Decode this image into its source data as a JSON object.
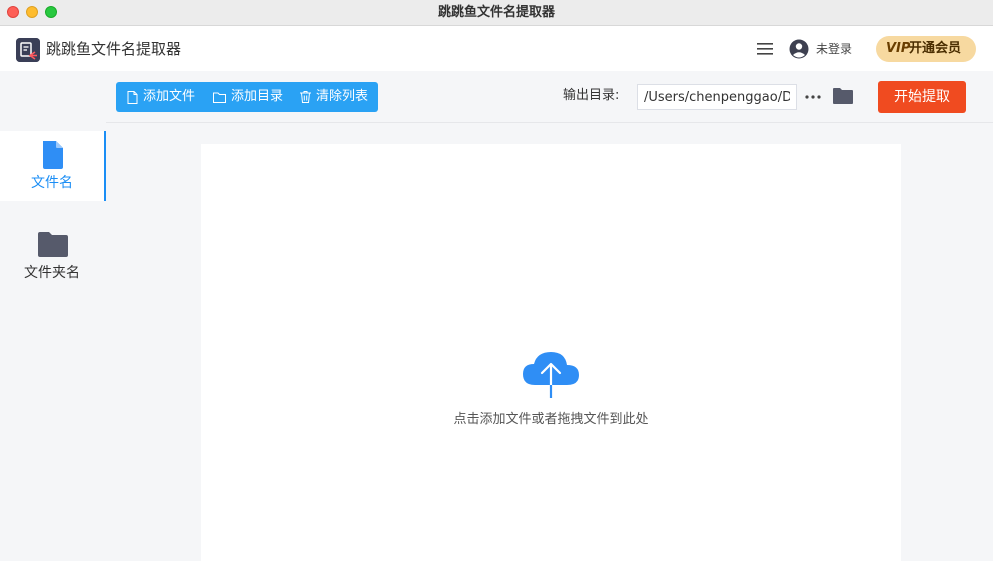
{
  "window": {
    "title": "跳跳鱼文件名提取器"
  },
  "header": {
    "app_name": "跳跳鱼文件名提取器",
    "login_text": "未登录",
    "vip_badge": "VIP",
    "vip_label": "开通会员",
    "icons": [
      "app-logo-icon",
      "menu-icon",
      "user-icon",
      "vip-icon"
    ]
  },
  "sidebar": {
    "items": [
      {
        "label": "文件名",
        "icon": "file-icon",
        "active": true
      },
      {
        "label": "文件夹名",
        "icon": "folder-icon",
        "active": false
      }
    ]
  },
  "toolbar": {
    "add_file_label": "添加文件",
    "add_dir_label": "添加目录",
    "clear_list_label": "清除列表",
    "output_dir_label": "输出目录:",
    "output_dir_value": "/Users/chenpenggao/D",
    "more_label": "···",
    "start_label": "开始提取"
  },
  "drop_zone": {
    "hint": "点击添加文件或者拖拽文件到此处",
    "icon": "cloud-upload-icon"
  },
  "colors": {
    "accent": "#1b8ef5",
    "toolbar_blue": "#2aa2f4",
    "start_red": "#f04b20",
    "vip_gold": "#f7d9a0",
    "sidebar_bg": "#f5f6f8"
  }
}
